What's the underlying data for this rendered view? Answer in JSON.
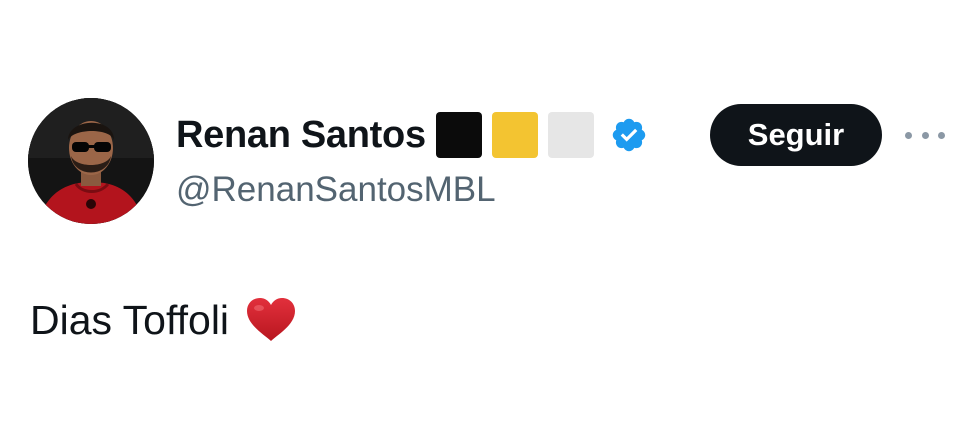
{
  "author": {
    "display_name": "Renan Santos",
    "handle": "@RenanSantosMBL",
    "name_emoji_squares": [
      {
        "icon": "black-square",
        "color": "#0b0b0b"
      },
      {
        "icon": "yellow-square",
        "color": "#f3c431"
      },
      {
        "icon": "white-square",
        "color": "#e6e6e6"
      }
    ],
    "verified_icon": "verified-badge-icon",
    "verified_color": "#1d9bf0"
  },
  "actions": {
    "follow_label": "Seguir",
    "more_icon": "more-icon"
  },
  "tweet": {
    "text": "Dias Toffoli",
    "emoji_icon": "red-heart-icon",
    "emoji_color": "#c8202b"
  },
  "colors": {
    "text_primary": "#0f1419",
    "text_secondary": "#536471",
    "button_bg": "#0f1419"
  }
}
